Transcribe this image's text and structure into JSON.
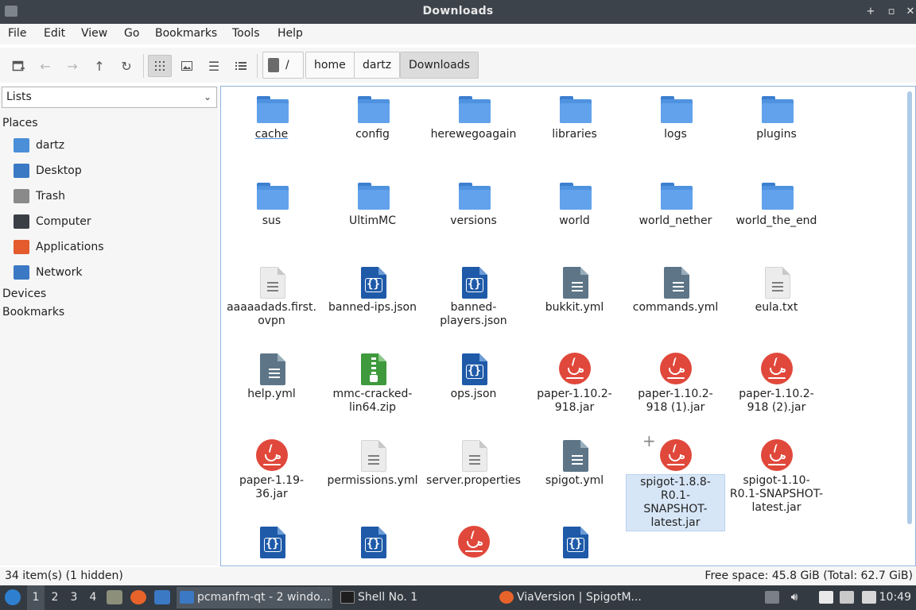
{
  "window": {
    "title": "Downloads",
    "buttons": [
      "+",
      "▫",
      "✕"
    ]
  },
  "menu": [
    "File",
    "Edit",
    "View",
    "Go",
    "Bookmarks",
    "Tools",
    "Help"
  ],
  "breadcrumb": {
    "root": "/",
    "parts": [
      "home",
      "dartz",
      "Downloads"
    ]
  },
  "sidebar": {
    "mode": "Lists",
    "places_header": "Places",
    "places": [
      {
        "label": "dartz",
        "icon": "home-folder-icon",
        "color": "#4a8fd8"
      },
      {
        "label": "Desktop",
        "icon": "desktop-icon",
        "color": "#3b79c4"
      },
      {
        "label": "Trash",
        "icon": "trash-icon",
        "color": "#8a8a8a"
      },
      {
        "label": "Computer",
        "icon": "computer-icon",
        "color": "#3a3f46"
      },
      {
        "label": "Applications",
        "icon": "applications-icon",
        "color": "#e45b2e"
      },
      {
        "label": "Network",
        "icon": "network-icon",
        "color": "#3b79c4"
      }
    ],
    "devices_header": "Devices",
    "bookmarks_header": "Bookmarks"
  },
  "files": [
    {
      "name": "cache",
      "type": "folder"
    },
    {
      "name": "config",
      "type": "folder"
    },
    {
      "name": "herewegoagain",
      "type": "folder"
    },
    {
      "name": "libraries",
      "type": "folder"
    },
    {
      "name": "logs",
      "type": "folder"
    },
    {
      "name": "plugins",
      "type": "folder"
    },
    {
      "name": "sus",
      "type": "folder"
    },
    {
      "name": "UltimMC",
      "type": "folder"
    },
    {
      "name": "versions",
      "type": "folder"
    },
    {
      "name": "world",
      "type": "folder"
    },
    {
      "name": "world_nether",
      "type": "folder"
    },
    {
      "name": "world_the_end",
      "type": "folder"
    },
    {
      "name": "aaaaadads.first.ovpn",
      "type": "text"
    },
    {
      "name": "banned-ips.json",
      "type": "json"
    },
    {
      "name": "banned-players.json",
      "type": "json"
    },
    {
      "name": "bukkit.yml",
      "type": "yml"
    },
    {
      "name": "commands.yml",
      "type": "yml"
    },
    {
      "name": "eula.txt",
      "type": "text"
    },
    {
      "name": "help.yml",
      "type": "yml"
    },
    {
      "name": "mmc-cracked-lin64.zip",
      "type": "zip"
    },
    {
      "name": "ops.json",
      "type": "json"
    },
    {
      "name": "paper-1.10.2-918.jar",
      "type": "jar"
    },
    {
      "name": "paper-1.10.2-918 (1).jar",
      "type": "jar"
    },
    {
      "name": "paper-1.10.2-918 (2).jar",
      "type": "jar"
    },
    {
      "name": "paper-1.19-36.jar",
      "type": "jar"
    },
    {
      "name": "permissions.yml",
      "type": "text"
    },
    {
      "name": "server.properties",
      "type": "text"
    },
    {
      "name": "spigot.yml",
      "type": "yml"
    },
    {
      "name": "spigot-1.8.8-R0.1-SNAPSHOT-latest.jar",
      "type": "jar"
    },
    {
      "name": "spigot-1.10-R0.1-SNAPSHOT-latest.jar",
      "type": "jar"
    },
    {
      "name": "",
      "type": "json"
    },
    {
      "name": "",
      "type": "json"
    },
    {
      "name": "",
      "type": "jar"
    },
    {
      "name": "",
      "type": "json"
    }
  ],
  "status": {
    "items": "34 item(s) (1 hidden)",
    "free_space": "Free space: 45.8 GiB (Total: 62.7 GiB)"
  },
  "taskbar": {
    "workspaces": [
      "1",
      "2",
      "3",
      "4"
    ],
    "tasks": [
      {
        "label": "pcmanfm-qt - 2 windo...",
        "icon": "file-manager-icon",
        "color": "#3b79c4"
      },
      {
        "label": "Shell No. 1",
        "icon": "terminal-icon",
        "color": "#1e1e1e"
      },
      {
        "label": "ViaVersion | SpigotM...",
        "icon": "firefox-icon",
        "color": "#e8632a"
      }
    ],
    "clock": "10:49"
  }
}
